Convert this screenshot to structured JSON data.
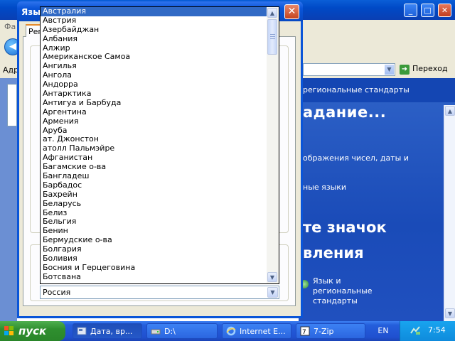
{
  "background_window": {
    "menu_hint": "Фа",
    "address_label": "Адр",
    "go_label": "Переход",
    "panel": {
      "header_link": "региональные стандарты",
      "big_text_1": "адание...",
      "text_1": "ображения чисел, даты и",
      "text_2": "ные языки",
      "big_text_2": "те значок",
      "big_text_3": "вления",
      "item_line_1": "Язык и",
      "item_line_2": "региональные",
      "item_line_3": "стандарты"
    }
  },
  "dialog": {
    "title": "Язык",
    "tab_label": "Регио",
    "combo_value": "Россия",
    "list_items": [
      "Австралия",
      "Австрия",
      "Азербайджан",
      "Албания",
      "Алжир",
      "Американское Самоа",
      "Ангилья",
      "Ангола",
      "Андорра",
      "Антарктика",
      "Антигуа и Барбуда",
      "Аргентина",
      "Армения",
      "Аруба",
      "ат. Джонстон",
      "атолл Пальмэйре",
      "Афганистан",
      "Багамские о-ва",
      "Бангладеш",
      "Барбадос",
      "Бахрейн",
      "Беларусь",
      "Белиз",
      "Бельгия",
      "Бенин",
      "Бермудские о-ва",
      "Болгария",
      "Боливия",
      "Босния и Герцеговина",
      "Ботсвана"
    ],
    "selected_index": 0
  },
  "taskbar": {
    "start_label": "пуск",
    "tasks": [
      {
        "label": "Дата, вр..."
      },
      {
        "label": "D:\\"
      },
      {
        "label": "Internet E..."
      },
      {
        "label": "7-Zip"
      }
    ],
    "language": "EN",
    "clock": "7:54"
  },
  "colors": {
    "selection": "#316ac5",
    "title_blue": "#0a55d8",
    "panel_blue": "#1a4bb8",
    "start_green": "#2f8f2f"
  }
}
